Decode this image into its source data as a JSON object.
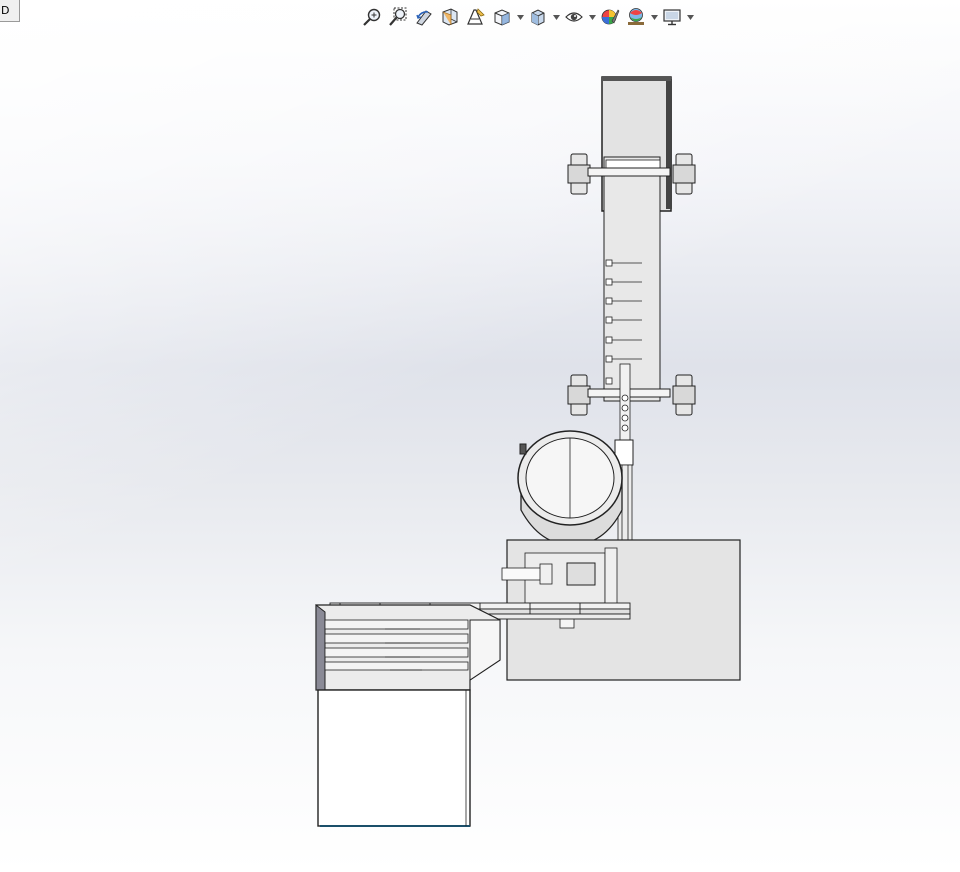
{
  "tab_label": "D",
  "toolbar": {
    "items": [
      {
        "name": "zoom-to-fit-icon",
        "dropdown": false
      },
      {
        "name": "zoom-to-area-icon",
        "dropdown": false
      },
      {
        "name": "previous-view-icon",
        "dropdown": false
      },
      {
        "name": "section-view-icon",
        "dropdown": false
      },
      {
        "name": "dynamic-annotation-views-icon",
        "dropdown": false
      },
      {
        "name": "view-orientation-icon",
        "dropdown": true
      },
      {
        "name": "display-style-icon",
        "dropdown": true
      },
      {
        "name": "hide-show-items-icon",
        "dropdown": true
      },
      {
        "name": "edit-appearance-icon",
        "dropdown": false
      },
      {
        "name": "apply-scene-icon",
        "dropdown": true
      },
      {
        "name": "view-settings-icon",
        "dropdown": true
      }
    ]
  },
  "colors": {
    "part_fill": "#e6e6e6",
    "part_edge": "#222222",
    "edge_accent": "#1b4f6a",
    "bg_top": "#ffffff",
    "bg_mid": "#dfe2ea"
  }
}
